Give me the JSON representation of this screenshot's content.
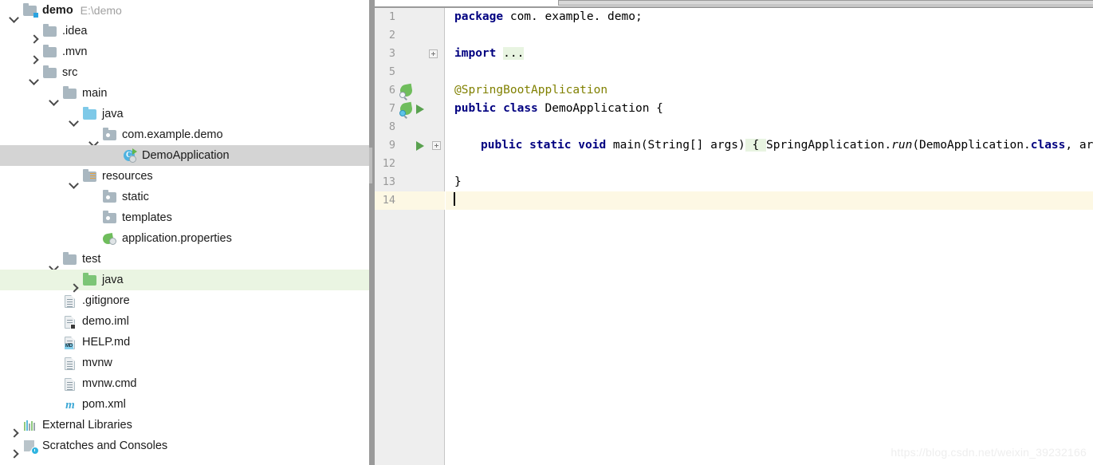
{
  "window": {
    "watermark": "https://blog.csdn.net/weixin_39232166"
  },
  "colors": {
    "selection_gray": "#d4d4d4",
    "highlight_green": "#eaf5e2",
    "caret_line": "#fdf8e4",
    "keyword_blue": "#000080",
    "annotation_olive": "#808000",
    "fold_green": "#e8f4e1",
    "gutter_bg": "#eeeeee",
    "folder_gray": "#a9b7c0",
    "folder_blue": "#7ec9e8",
    "folder_green": "#7cc576",
    "run_green": "#59a14f",
    "splitter_gray": "#9a9a9a"
  },
  "project_tree": {
    "items": [
      {
        "label": "demo",
        "path_hint": "E:\\demo",
        "depth": 0,
        "arrow": "down",
        "icon": "module-folder-icon",
        "bold": true,
        "state": "normal"
      },
      {
        "label": ".idea",
        "path_hint": "",
        "depth": 1,
        "arrow": "right",
        "icon": "folder-gray-icon",
        "bold": false,
        "state": "normal"
      },
      {
        "label": ".mvn",
        "path_hint": "",
        "depth": 1,
        "arrow": "right",
        "icon": "folder-gray-icon",
        "bold": false,
        "state": "normal"
      },
      {
        "label": "src",
        "path_hint": "",
        "depth": 1,
        "arrow": "down",
        "icon": "folder-gray-icon",
        "bold": false,
        "state": "normal"
      },
      {
        "label": "main",
        "path_hint": "",
        "depth": 2,
        "arrow": "down",
        "icon": "folder-gray-icon",
        "bold": false,
        "state": "normal"
      },
      {
        "label": "java",
        "path_hint": "",
        "depth": 3,
        "arrow": "down",
        "icon": "source-root-blue-icon",
        "bold": false,
        "state": "normal"
      },
      {
        "label": "com.example.demo",
        "path_hint": "",
        "depth": 4,
        "arrow": "down",
        "icon": "package-icon",
        "bold": false,
        "state": "normal"
      },
      {
        "label": "DemoApplication",
        "path_hint": "",
        "depth": 5,
        "arrow": "none",
        "icon": "java-class-runnable-icon",
        "bold": false,
        "state": "selected"
      },
      {
        "label": "resources",
        "path_hint": "",
        "depth": 3,
        "arrow": "down",
        "icon": "resources-root-icon",
        "bold": false,
        "state": "normal"
      },
      {
        "label": "static",
        "path_hint": "",
        "depth": 4,
        "arrow": "none",
        "icon": "package-icon",
        "bold": false,
        "state": "normal"
      },
      {
        "label": "templates",
        "path_hint": "",
        "depth": 4,
        "arrow": "none",
        "icon": "package-icon",
        "bold": false,
        "state": "normal"
      },
      {
        "label": "application.properties",
        "path_hint": "",
        "depth": 4,
        "arrow": "none",
        "icon": "spring-properties-icon",
        "bold": false,
        "state": "normal"
      },
      {
        "label": "test",
        "path_hint": "",
        "depth": 2,
        "arrow": "down",
        "icon": "folder-gray-icon",
        "bold": false,
        "state": "normal"
      },
      {
        "label": "java",
        "path_hint": "",
        "depth": 3,
        "arrow": "right",
        "icon": "test-root-green-icon",
        "bold": false,
        "state": "greenhl"
      },
      {
        "label": ".gitignore",
        "path_hint": "",
        "depth": 2,
        "arrow": "none",
        "icon": "file-text-icon",
        "bold": false,
        "state": "normal"
      },
      {
        "label": "demo.iml",
        "path_hint": "",
        "depth": 2,
        "arrow": "none",
        "icon": "file-iml-icon",
        "bold": false,
        "state": "normal"
      },
      {
        "label": "HELP.md",
        "path_hint": "",
        "depth": 2,
        "arrow": "none",
        "icon": "file-markdown-icon",
        "bold": false,
        "state": "normal"
      },
      {
        "label": "mvnw",
        "path_hint": "",
        "depth": 2,
        "arrow": "none",
        "icon": "file-text-icon",
        "bold": false,
        "state": "normal"
      },
      {
        "label": "mvnw.cmd",
        "path_hint": "",
        "depth": 2,
        "arrow": "none",
        "icon": "file-text-icon",
        "bold": false,
        "state": "normal"
      },
      {
        "label": "pom.xml",
        "path_hint": "",
        "depth": 2,
        "arrow": "none",
        "icon": "maven-pom-icon",
        "bold": false,
        "state": "normal"
      },
      {
        "label": "External Libraries",
        "path_hint": "",
        "depth": 0,
        "arrow": "right",
        "icon": "external-libraries-icon",
        "bold": false,
        "state": "normal"
      },
      {
        "label": "Scratches and Consoles",
        "path_hint": "",
        "depth": 0,
        "arrow": "right",
        "icon": "scratches-icon",
        "bold": false,
        "state": "normal"
      }
    ]
  },
  "editor": {
    "gutter": [
      {
        "num": "1",
        "icons": [],
        "fold": "none",
        "caret": false
      },
      {
        "num": "2",
        "icons": [],
        "fold": "none",
        "caret": false
      },
      {
        "num": "3",
        "icons": [],
        "fold": "collapsed",
        "caret": false
      },
      {
        "num": "5",
        "icons": [],
        "fold": "none",
        "caret": false
      },
      {
        "num": "6",
        "icons": [
          "spring-bean-search-icon"
        ],
        "fold": "none",
        "caret": false
      },
      {
        "num": "7",
        "icons": [
          "spring-boot-icon",
          "run-gutter-icon"
        ],
        "fold": "none",
        "caret": false
      },
      {
        "num": "8",
        "icons": [],
        "fold": "none",
        "caret": false
      },
      {
        "num": "9",
        "icons": [
          "run-gutter-icon"
        ],
        "fold": "collapsed",
        "caret": false
      },
      {
        "num": "12",
        "icons": [],
        "fold": "none",
        "caret": false
      },
      {
        "num": "13",
        "icons": [],
        "fold": "none",
        "caret": false
      },
      {
        "num": "14",
        "icons": [],
        "fold": "none",
        "caret": true
      }
    ],
    "code": {
      "line1_kw": "package",
      "line1_rest": " com. example. demo;",
      "line3_kw": "import",
      "line3_fold": "...",
      "line6_annotation": "@SpringBootApplication",
      "line7_kw1": "public",
      "line7_kw2": "class",
      "line7_rest": " DemoApplication {",
      "line9_kw1": "public",
      "line9_kw2": "static",
      "line9_kw3": "void",
      "line9_sig": " main(String[] args)",
      "line9_fold_open": " { ",
      "line9_body_a": "SpringApplication.",
      "line9_body_run": "run",
      "line9_body_b": "(DemoApplication.",
      "line9_body_kw": "class",
      "line9_body_c": ", args); ",
      "line9_fold_close": "}",
      "line13_brace": "}",
      "line14_text": ""
    }
  }
}
